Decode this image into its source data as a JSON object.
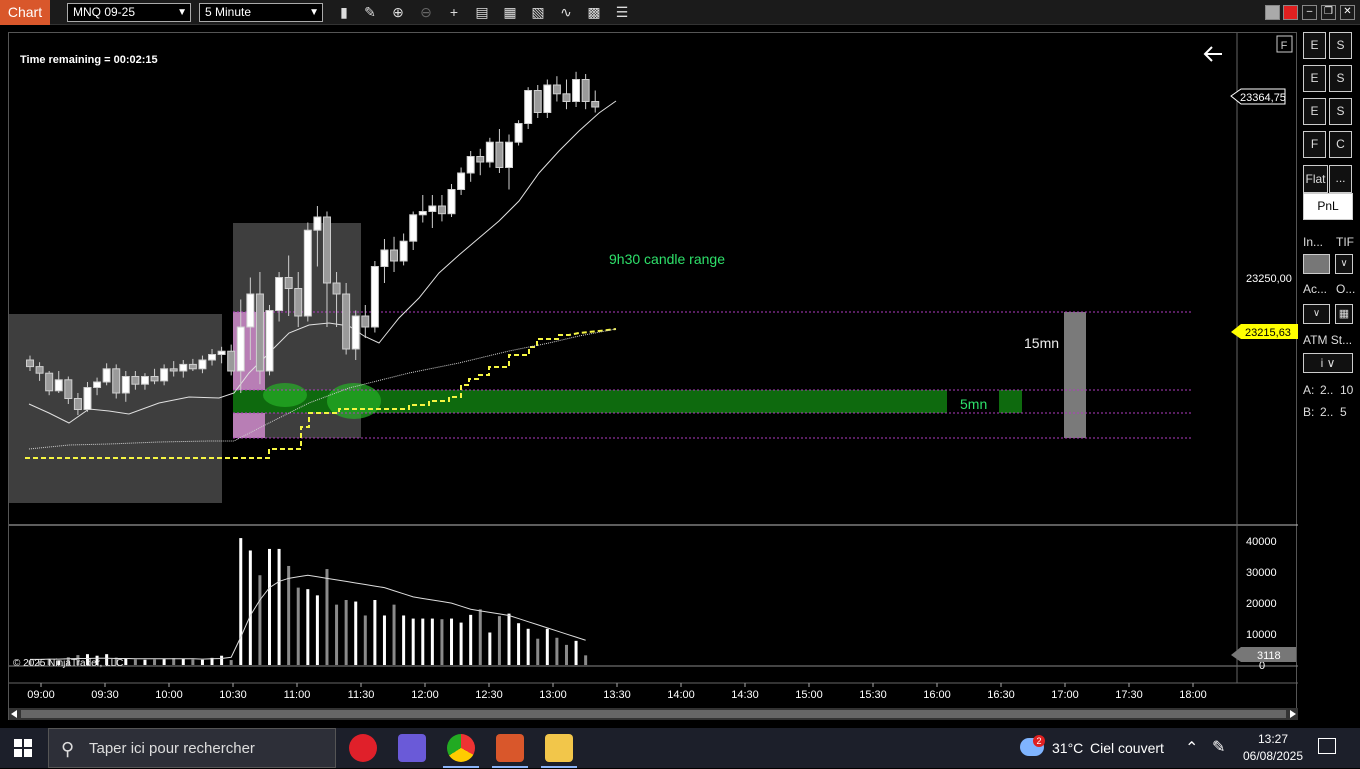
{
  "title_bar": {
    "app_tag": "Chart",
    "instrument": "MNQ 09-25",
    "interval": "5 Minute"
  },
  "chart": {
    "time_remaining": "Time remaining = 00:02:15",
    "annotation_range": "9h30 candle range",
    "label_5mn": "5mn",
    "label_15mn": "15mn",
    "copyright": "© 2025 NinjaTrader, LLC",
    "last_price": "23364,75",
    "price_tick": "23250,00",
    "marker_price": "23215,63",
    "volume_last": "3118",
    "flag_label": "F"
  },
  "chart_data": {
    "type": "candlestick",
    "price_axis": {
      "min": 23020,
      "max": 23420,
      "ticks": [
        "23250,00"
      ]
    },
    "volume_axis": {
      "min": 0,
      "max": 42000,
      "ticks": [
        "40000",
        "30000",
        "20000",
        "10000",
        "0"
      ]
    },
    "time_axis": [
      "09:00",
      "09:30",
      "10:00",
      "10:30",
      "11:00",
      "11:30",
      "12:00",
      "12:30",
      "13:00",
      "13:30",
      "14:00",
      "14:30",
      "15:00",
      "15:30",
      "16:00",
      "16:30",
      "17:00",
      "17:30",
      "18:00"
    ],
    "levels": {
      "range_high": 23229,
      "range_low": 23130,
      "mid_high": 23175,
      "mid_low": 23164
    },
    "candles": [
      [
        23150,
        23154,
        23140,
        23144
      ],
      [
        23144,
        23148,
        23131,
        23138
      ],
      [
        23138,
        23140,
        23118,
        23122
      ],
      [
        23122,
        23140,
        23120,
        23132
      ],
      [
        23132,
        23135,
        23110,
        23115
      ],
      [
        23115,
        23120,
        23100,
        23105
      ],
      [
        23105,
        23130,
        23103,
        23125
      ],
      [
        23125,
        23134,
        23118,
        23130
      ],
      [
        23130,
        23147,
        23127,
        23142
      ],
      [
        23142,
        23146,
        23115,
        23120
      ],
      [
        23120,
        23140,
        23112,
        23135
      ],
      [
        23135,
        23140,
        23123,
        23128
      ],
      [
        23128,
        23138,
        23123,
        23135
      ],
      [
        23135,
        23142,
        23128,
        23131
      ],
      [
        23131,
        23146,
        23127,
        23142
      ],
      [
        23142,
        23149,
        23135,
        23140
      ],
      [
        23140,
        23150,
        23134,
        23146
      ],
      [
        23146,
        23151,
        23140,
        23142
      ],
      [
        23142,
        23154,
        23138,
        23150
      ],
      [
        23150,
        23160,
        23145,
        23155
      ],
      [
        23155,
        23162,
        23147,
        23158
      ],
      [
        23158,
        23164,
        23136,
        23140
      ],
      [
        23140,
        23205,
        23120,
        23180
      ],
      [
        23180,
        23225,
        23150,
        23210
      ],
      [
        23210,
        23230,
        23128,
        23140
      ],
      [
        23140,
        23200,
        23136,
        23195
      ],
      [
        23195,
        23230,
        23185,
        23225
      ],
      [
        23225,
        23245,
        23190,
        23215
      ],
      [
        23215,
        23230,
        23180,
        23190
      ],
      [
        23190,
        23275,
        23185,
        23268
      ],
      [
        23268,
        23290,
        23235,
        23280
      ],
      [
        23280,
        23285,
        23180,
        23220
      ],
      [
        23220,
        23230,
        23180,
        23210
      ],
      [
        23210,
        23220,
        23155,
        23160
      ],
      [
        23160,
        23195,
        23150,
        23190
      ],
      [
        23190,
        23200,
        23170,
        23180
      ],
      [
        23180,
        23240,
        23175,
        23235
      ],
      [
        23235,
        23260,
        23220,
        23250
      ],
      [
        23250,
        23262,
        23230,
        23240
      ],
      [
        23240,
        23265,
        23236,
        23258
      ],
      [
        23258,
        23285,
        23250,
        23282
      ],
      [
        23282,
        23300,
        23275,
        23285
      ],
      [
        23285,
        23300,
        23270,
        23290
      ],
      [
        23290,
        23300,
        23276,
        23283
      ],
      [
        23283,
        23310,
        23280,
        23305
      ],
      [
        23305,
        23325,
        23300,
        23320
      ],
      [
        23320,
        23340,
        23312,
        23335
      ],
      [
        23335,
        23342,
        23318,
        23330
      ],
      [
        23330,
        23352,
        23325,
        23348
      ],
      [
        23348,
        23360,
        23320,
        23325
      ],
      [
        23325,
        23355,
        23305,
        23348
      ],
      [
        23348,
        23368,
        23345,
        23365
      ],
      [
        23365,
        23398,
        23360,
        23395
      ],
      [
        23395,
        23400,
        23370,
        23375
      ],
      [
        23375,
        23405,
        23370,
        23400
      ],
      [
        23400,
        23408,
        23385,
        23392
      ],
      [
        23392,
        23405,
        23378,
        23385
      ],
      [
        23385,
        23412,
        23380,
        23405
      ],
      [
        23405,
        23410,
        23378,
        23385
      ],
      [
        23385,
        23395,
        23375,
        23380
      ]
    ],
    "volumes": [
      1500,
      1200,
      2000,
      1500,
      2500,
      3200,
      3500,
      3000,
      3500,
      2400,
      2000,
      1800,
      1700,
      1800,
      1900,
      2200,
      2000,
      1800,
      1700,
      2300,
      3000,
      1600,
      41000,
      37000,
      29000,
      37500,
      37500,
      32000,
      25000,
      24500,
      22500,
      31000,
      19500,
      21000,
      20500,
      16000,
      21000,
      16000,
      19500,
      16000,
      15000,
      15000,
      15000,
      14800,
      15000,
      13700,
      16200,
      18000,
      10500,
      15800,
      16600,
      13500,
      11700,
      8500,
      11700,
      8800,
      6500,
      7800,
      3118
    ],
    "volume_ma": [
      1800,
      1800,
      1900,
      1900,
      2000,
      2100,
      2100,
      2200,
      2200,
      2100,
      2100,
      2000,
      2000,
      2000,
      2000,
      2000,
      2000,
      2000,
      1900,
      2000,
      2100,
      2500,
      9000,
      16000,
      21000,
      25000,
      27000,
      28000,
      28500,
      29000,
      28500,
      28000,
      27500,
      27000,
      26500,
      26000,
      25500,
      25000,
      24000,
      23000,
      22000,
      21500,
      21000,
      20500,
      20000,
      19000,
      18000,
      17500,
      17000,
      16500,
      16000,
      15000,
      14000,
      13000,
      12000,
      11000,
      10000,
      9000,
      8000
    ]
  },
  "right_panel": {
    "btn_rows": [
      [
        "E",
        "S"
      ],
      [
        "E",
        "S"
      ],
      [
        "E",
        "S"
      ],
      [
        "F",
        "C"
      ]
    ],
    "flat": "Flat",
    "dots": "...",
    "pnl": "PnL",
    "in_label": "In...",
    "tif_label": "TIF",
    "ac_label": "Ac...",
    "o_label": "O...",
    "atm_label": "ATM St...",
    "a_row": {
      "k": "A:",
      "v": "2..",
      "n": "10"
    },
    "b_row": {
      "k": "B:",
      "v": "2..",
      "n": "5"
    }
  },
  "taskbar": {
    "search_placeholder": "Taper ici pour rechercher",
    "weather_temp": "31°C",
    "weather_text": "Ciel couvert",
    "weather_badge": "2",
    "clock_time": "13:27",
    "clock_date": "06/08/2025"
  },
  "colors": {
    "accent": "#d9572b",
    "green_zone": "#0f6b0f",
    "pink_zone": "#e39ae0",
    "yellow_line": "#f5f542",
    "magenta_line": "#b03cc0",
    "price_marker": "#ffff00",
    "annotation_green": "#2ee06a"
  }
}
